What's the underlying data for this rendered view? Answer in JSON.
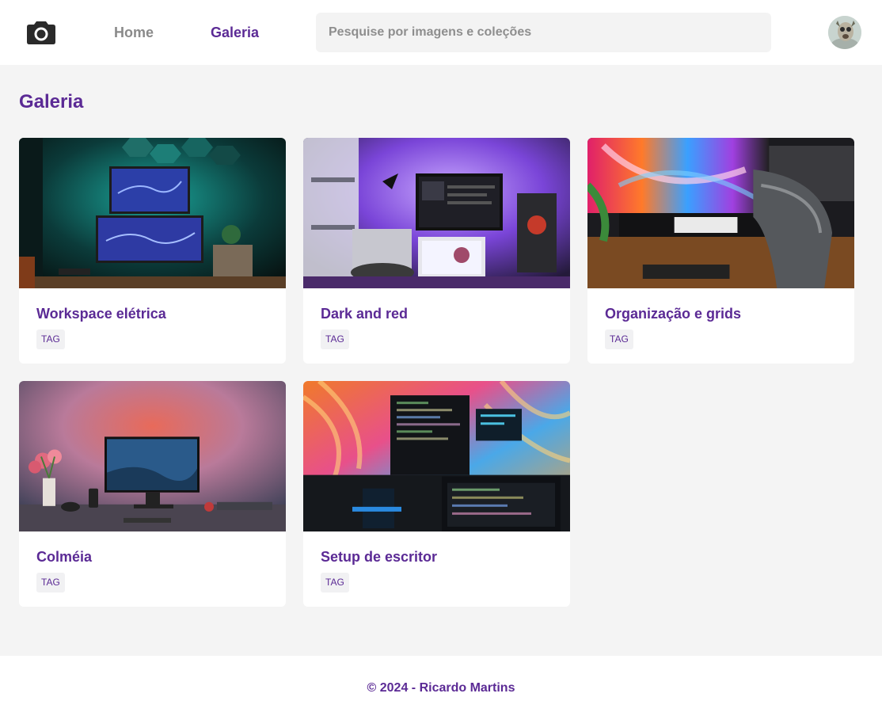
{
  "header": {
    "logo_icon": "camera-icon",
    "nav": [
      {
        "label": "Home"
      },
      {
        "label": "Galeria"
      }
    ],
    "search": {
      "placeholder": "Pesquise por imagens e coleções",
      "value": ""
    },
    "avatar_icon": "user-avatar"
  },
  "main": {
    "title": "Galeria",
    "cards": [
      {
        "title": "Workspace elétrica",
        "tag": "TAG"
      },
      {
        "title": "Dark and red",
        "tag": "TAG"
      },
      {
        "title": "Organização e grids",
        "tag": "TAG"
      },
      {
        "title": "Colméia",
        "tag": "TAG"
      },
      {
        "title": "Setup de escritor",
        "tag": "TAG"
      }
    ]
  },
  "footer": {
    "text": "© 2024 - Ricardo Martins"
  },
  "colors": {
    "accent": "#5b2a95",
    "nav_inactive": "#8a8a8a",
    "background": "#f4f4f4",
    "tag_bg": "#f1f1f3"
  }
}
